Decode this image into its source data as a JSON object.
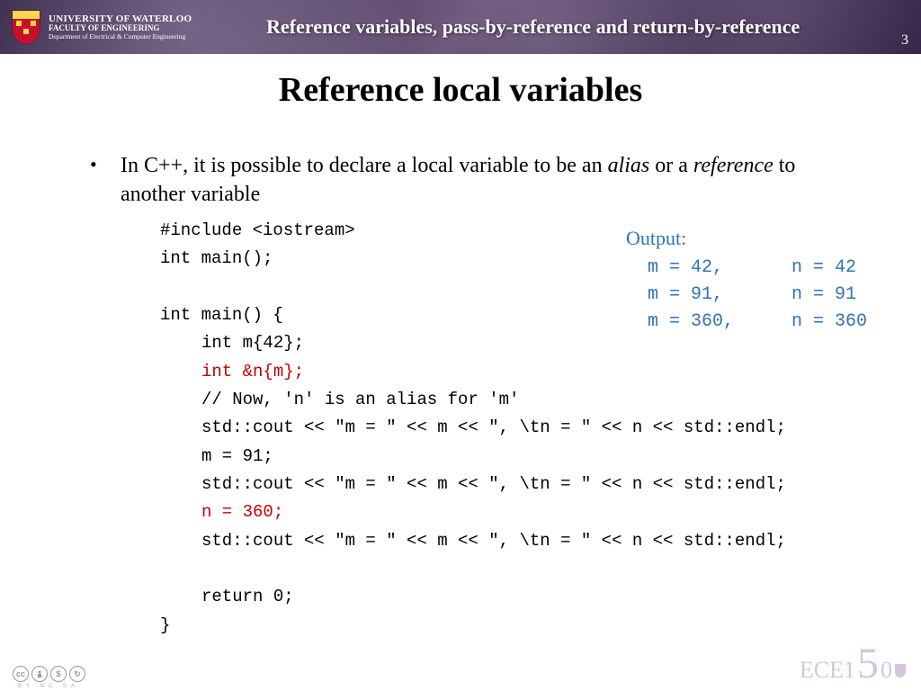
{
  "header": {
    "university": "UNIVERSITY OF WATERLOO",
    "faculty": "FACULTY OF ENGINEERING",
    "dept": "Department of Electrical & Computer Engineering",
    "topic": "Reference variables, pass-by-reference and return-by-reference",
    "slide_number": "3"
  },
  "title": "Reference local variables",
  "bullet": {
    "prefix": "In C++, it is possible to declare a local variable to be an ",
    "em1": "alias",
    "mid": " or a ",
    "em2": "reference",
    "suffix": " to another variable"
  },
  "code": {
    "l1": "#include <iostream>",
    "l2": "int main();",
    "l3": "",
    "l4": "int main() {",
    "l5": "int m{42};",
    "l6": "int &n{m};",
    "l7": "// Now, 'n' is an alias for 'm'",
    "l8": "std::cout << \"m = \" << m << \", \\tn = \" << n << std::endl;",
    "l9": "m = 91;",
    "l10": "std::cout << \"m = \" << m << \", \\tn = \" << n << std::endl;",
    "l11": "n = 360;",
    "l12": "std::cout << \"m = \" << m << \", \\tn = \" << n << std::endl;",
    "l13": "",
    "l14": "return 0;",
    "l15": "}"
  },
  "output": {
    "label": "Output:",
    "rows": [
      {
        "c1": "m = 42,",
        "c2": "n = 42"
      },
      {
        "c1": "m = 91,",
        "c2": "n = 91"
      },
      {
        "c1": "m = 360,",
        "c2": "n = 360"
      }
    ]
  },
  "footer": {
    "cc": "BY  NC  SA",
    "course_prefix": "ECE1",
    "course_big": "5",
    "course_suffix": "0"
  }
}
